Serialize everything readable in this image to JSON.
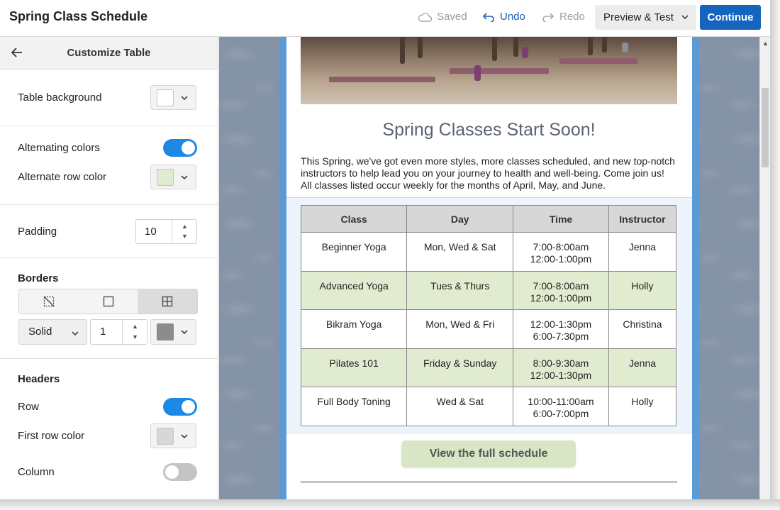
{
  "app": {
    "title": "Spring Class Schedule"
  },
  "toolbar": {
    "saved_label": "Saved",
    "undo_label": "Undo",
    "redo_label": "Redo",
    "preview_label": "Preview & Test",
    "continue_label": "Continue"
  },
  "panel": {
    "title": "Customize Table",
    "table_background": {
      "label": "Table background",
      "color": "#ffffff"
    },
    "alternating_colors": {
      "label": "Alternating colors",
      "on": true
    },
    "alternate_row_color": {
      "label": "Alternate row color",
      "color": "#e1ebcf"
    },
    "padding": {
      "label": "Padding",
      "value": "10"
    },
    "borders": {
      "title": "Borders",
      "options": [
        "no-border-icon",
        "outer-border-icon",
        "all-borders-icon"
      ],
      "selected": "all-borders-icon",
      "style": "Solid",
      "width": "1",
      "color": "#8c8c8c"
    },
    "headers": {
      "title": "Headers",
      "row": {
        "label": "Row",
        "on": true
      },
      "first_row_color": {
        "label": "First row color",
        "color": "#d7d7d7"
      },
      "column": {
        "label": "Column",
        "on": false
      }
    }
  },
  "email": {
    "heading": "Spring Classes Start Soon!",
    "intro": "This Spring, we've got even more styles, more classes scheduled, and new top-notch instructors to help lead you on your journey to health and well-being. Come join us! All classes listed occur weekly for the months of April, May, and June.",
    "table": {
      "headers": [
        "Class",
        "Day",
        "Time",
        "Instructor"
      ],
      "rows": [
        {
          "class": "Beginner Yoga",
          "day": "Mon, Wed & Sat",
          "time1": "7:00-8:00am",
          "time2": "12:00-1:00pm",
          "instructor": "Jenna"
        },
        {
          "class": "Advanced Yoga",
          "day": "Tues & Thurs",
          "time1": "7:00-8:00am",
          "time2": "12:00-1:00pm",
          "instructor": "Holly"
        },
        {
          "class": "Bikram Yoga",
          "day": "Mon, Wed & Fri",
          "time1": "12:00-1:30pm",
          "time2": "6:00-7:30pm",
          "instructor": "Christina"
        },
        {
          "class": "Pilates 101",
          "day": "Friday & Sunday",
          "time1": "8:00-9:30am",
          "time2": "12:00-1:30pm",
          "instructor": "Jenna"
        },
        {
          "class": "Full Body Toning",
          "day": "Wed & Sat",
          "time1": "10:00-11:00am",
          "time2": "6:00-7:00pm",
          "instructor": "Holly"
        }
      ]
    },
    "cta_label": "View the full schedule"
  },
  "colors": {
    "accent": "#1565c0",
    "toggle_on": "#1e88e5",
    "email_frame": "#5b9bd5",
    "canvas_bg": "#8593a6"
  }
}
